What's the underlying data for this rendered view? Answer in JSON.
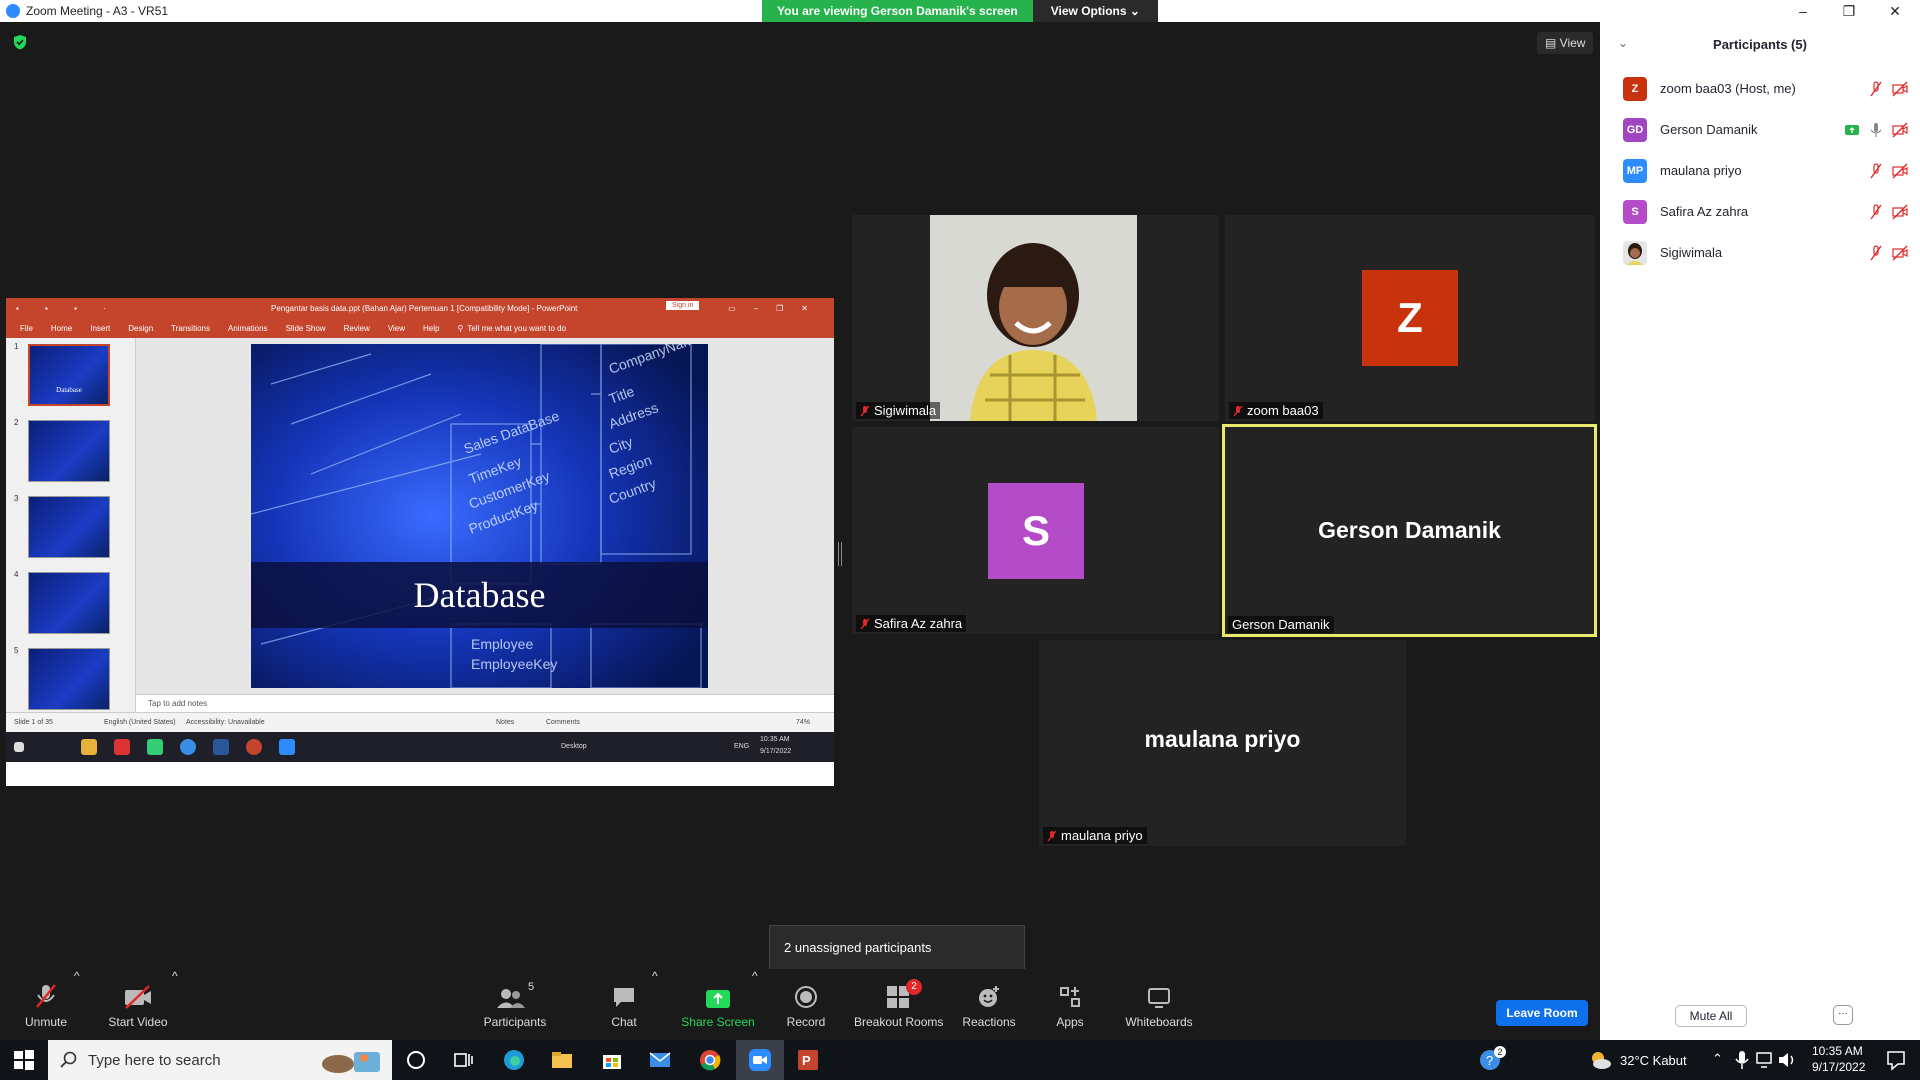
{
  "window": {
    "title": "Zoom Meeting - A3 - VR51",
    "minimize": "–",
    "restore": "❐",
    "close": "✕"
  },
  "share_banner": {
    "message": "You are viewing Gerson Damanik's screen",
    "options": "View Options ⌄"
  },
  "view_button": "▤ View",
  "shared_screen": {
    "ppt_title": "Pengantar basis data.ppt (Bahan Ajar) Pertemuan 1 [Compatibility Mode] - PowerPoint",
    "sign_in": "Sign in",
    "ribbon_tabs": [
      "File",
      "Home",
      "Insert",
      "Design",
      "Transitions",
      "Animations",
      "Slide Show",
      "Review",
      "View",
      "Help"
    ],
    "tell_me": "Tell me what you want to do",
    "thumb_numbers": [
      "1",
      "2",
      "3",
      "4",
      "5"
    ],
    "thumb1_label": "Database",
    "slide_title": "Database",
    "notes_placeholder": "Tap to add notes",
    "status_slide": "Slide 1 of 35",
    "status_language": "English (United States)",
    "status_accessibility": "Accessibility: Unavailable",
    "status_notes": "Notes",
    "status_comments": "Comments",
    "status_zoom": "74%",
    "inner_desktop": "Desktop",
    "inner_lang": "ENG",
    "inner_time": "10:35 AM",
    "inner_date": "9/17/2022"
  },
  "videos": [
    {
      "name": "Sigiwimala",
      "muted": true
    },
    {
      "name": "zoom baa03",
      "initial": "Z",
      "muted": true,
      "color": "#c8330e"
    },
    {
      "name": "Safira Az zahra",
      "initial": "S",
      "muted": true,
      "color": "#b44bc7"
    },
    {
      "name": "Gerson Damanik",
      "big_label": "Gerson Damanik",
      "active_speaker": true
    },
    {
      "name": "maulana priyo",
      "big_label": "maulana priyo",
      "muted": true
    }
  ],
  "tooltip": "2 unassigned participants",
  "toolbar": {
    "unmute": "Unmute",
    "start_video": "Start Video",
    "participants": "Participants",
    "participants_count": "5",
    "chat": "Chat",
    "share_screen": "Share Screen",
    "record": "Record",
    "breakout_rooms": "Breakout Rooms",
    "breakout_badge": "2",
    "reactions": "Reactions",
    "apps": "Apps",
    "whiteboards": "Whiteboards",
    "leave_room": "Leave Room"
  },
  "participants_panel": {
    "title": "Participants (5)",
    "items": [
      {
        "initials": "Z",
        "name": "zoom baa03 (Host, me)",
        "color": "#c8330e"
      },
      {
        "initials": "GD",
        "name": "Gerson Damanik",
        "color": "#a046c2"
      },
      {
        "initials": "MP",
        "name": "maulana priyo",
        "color": "#2d8cff"
      },
      {
        "initials": "S",
        "name": "Safira Az zahra",
        "color": "#b44bc7"
      },
      {
        "initials": "",
        "name": "Sigiwimala",
        "color": "#dddddd"
      }
    ],
    "mute_all": "Mute All",
    "more": "···"
  },
  "taskbar": {
    "search_placeholder": "Type here to search",
    "weather": "32°C  Kabut",
    "time": "10:35 AM",
    "date": "9/17/2022",
    "badge": "2"
  }
}
